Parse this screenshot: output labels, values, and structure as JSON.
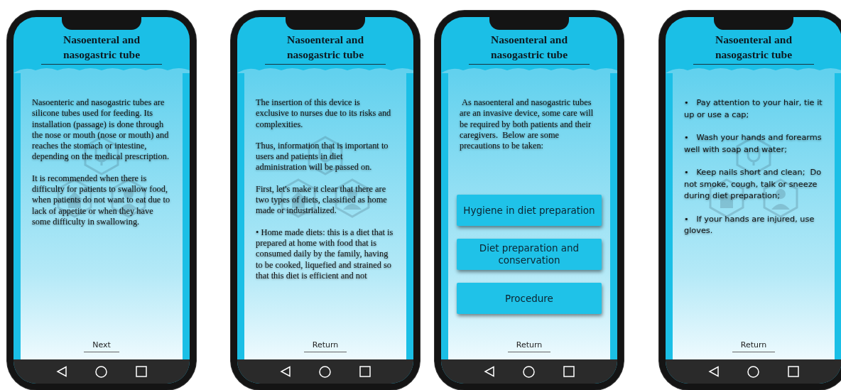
{
  "screens": [
    {
      "title": "Nasoenteral and nasogastric tube",
      "kind": "prose",
      "background_icons": true,
      "paragraphs": [
        "Nasoenteric and nasogastric tubes are silicone tubes used for feeding. Its installation (passage) is done through the nose or mouth (nose or mouth) and reaches the stomach or intestine, depending on the medical prescription.",
        "It is recommended when there is difficulty for patients to swallow food, when patients do not want to eat due to lack of appetite or when they have some difficulty in swallowing."
      ],
      "footer_link": "Next"
    },
    {
      "title": "Nasoenteral and nasogastric tube",
      "kind": "prose",
      "background_icons": true,
      "paragraphs": [
        "The insertion of this device is exclusive to nurses due to its risks and complexities.",
        "Thus, information that is important to users and patients in diet administration will be passed on.",
        "First, let's make it clear that there are two types of diets, classified as home made or industrialized.",
        "• Home made diets: this is a diet that is prepared at home with food that is consumed daily by the family, having to be cooked, liquefied and strained so that this diet is efficient and not"
      ],
      "footer_link": "Return"
    },
    {
      "title": "Nasoenteral and nasogastric tube",
      "kind": "prose",
      "background_icons": false,
      "paragraphs": [
        " As nasoenteral and nasogastric tubes are an invasive device, some care will be required by both patients and their caregivers.  Below are some precautions to be taken:"
      ],
      "buttons": [
        "Hygiene in diet preparation",
        "Diet preparation and conservation",
        "Procedure"
      ],
      "footer_link": "Return"
    },
    {
      "title": "Nasoenteral and nasogastric tube",
      "kind": "bullets",
      "background_icons": true,
      "paragraphs": [
        "•   Pay attention to your hair, tie it up or use a cap;",
        "•   Wash your hands and forearms well with soap and water;",
        "•   Keep nails short and clean;  Do not smoke, cough, talk or sneeze during diet preparation;",
        "•   If your hands are injured, use gloves."
      ],
      "footer_link": "Return"
    }
  ]
}
